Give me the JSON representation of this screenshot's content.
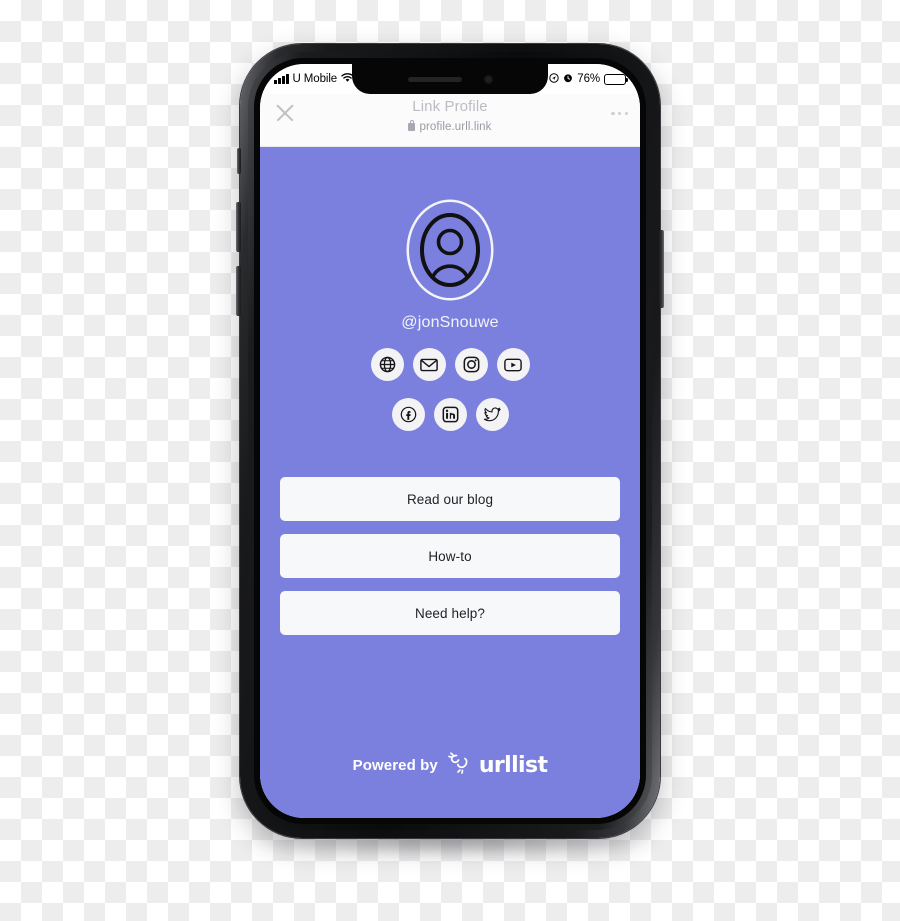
{
  "status_bar": {
    "carrier": "U Mobile",
    "signal_icon": "signal-bars-icon",
    "wifi_icon": "wifi-icon",
    "location_icon": "location-arrow-icon",
    "alarm_icon": "alarm-icon",
    "battery_percent": "76%",
    "battery_level": 76,
    "battery_icon": "battery-icon"
  },
  "browser": {
    "close_icon": "close-icon",
    "title": "Link Profile",
    "lock_icon": "lock-icon",
    "url": "profile.urll.link",
    "menu_icon": "more-options-icon"
  },
  "profile": {
    "avatar_icon": "user-avatar-placeholder-icon",
    "handle": "@jonSnouwe"
  },
  "socials": {
    "row1": [
      {
        "name": "website-icon",
        "label": "Website"
      },
      {
        "name": "email-icon",
        "label": "Email"
      },
      {
        "name": "instagram-icon",
        "label": "Instagram"
      },
      {
        "name": "youtube-icon",
        "label": "YouTube"
      }
    ],
    "row2": [
      {
        "name": "facebook-icon",
        "label": "Facebook"
      },
      {
        "name": "linkedin-icon",
        "label": "LinkedIn"
      },
      {
        "name": "twitter-icon",
        "label": "Twitter"
      }
    ]
  },
  "links": [
    {
      "label": "Read our blog"
    },
    {
      "label": "How-to"
    },
    {
      "label": "Need help?"
    }
  ],
  "footer": {
    "powered_by": "Powered by",
    "brand_logo_icon": "urllist-logo-icon",
    "brand_name": "urllist"
  },
  "colors": {
    "page_background": "#7B80DE",
    "link_button": "#F7F8FA",
    "social_circle": "#F3F3F5",
    "text_light": "#FFFFFF",
    "browser_chrome": "#FBFBFC",
    "title_gray": "#BCBCC4"
  }
}
